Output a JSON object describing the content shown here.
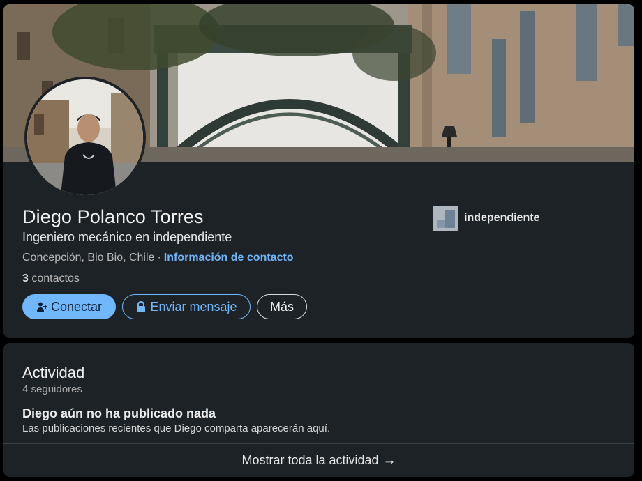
{
  "profile": {
    "name": "Diego Polanco Torres",
    "headline": "Ingeniero mecánico en independiente",
    "location": "Concepción, Bio Bio, Chile",
    "separator": "·",
    "contact_info_label": "Información de contacto",
    "connections_count": "3",
    "connections_label": "contactos",
    "company": "independiente"
  },
  "actions": {
    "connect_label": "Conectar",
    "message_label": "Enviar mensaje",
    "more_label": "Más"
  },
  "activity": {
    "title": "Actividad",
    "followers": "4 seguidores",
    "empty_title": "Diego aún no ha publicado nada",
    "empty_subtitle": "Las publicaciones recientes que Diego comparta aparecerán aquí.",
    "show_all_label": "Mostrar toda la actividad",
    "arrow_icon": "arrow-right-icon"
  },
  "icons": {
    "connect": "add-person-icon",
    "message": "lock-icon"
  },
  "colors": {
    "card_background": "#1d2226",
    "page_background": "#000000",
    "accent": "#71b7fb",
    "link": "#70b5f9"
  }
}
